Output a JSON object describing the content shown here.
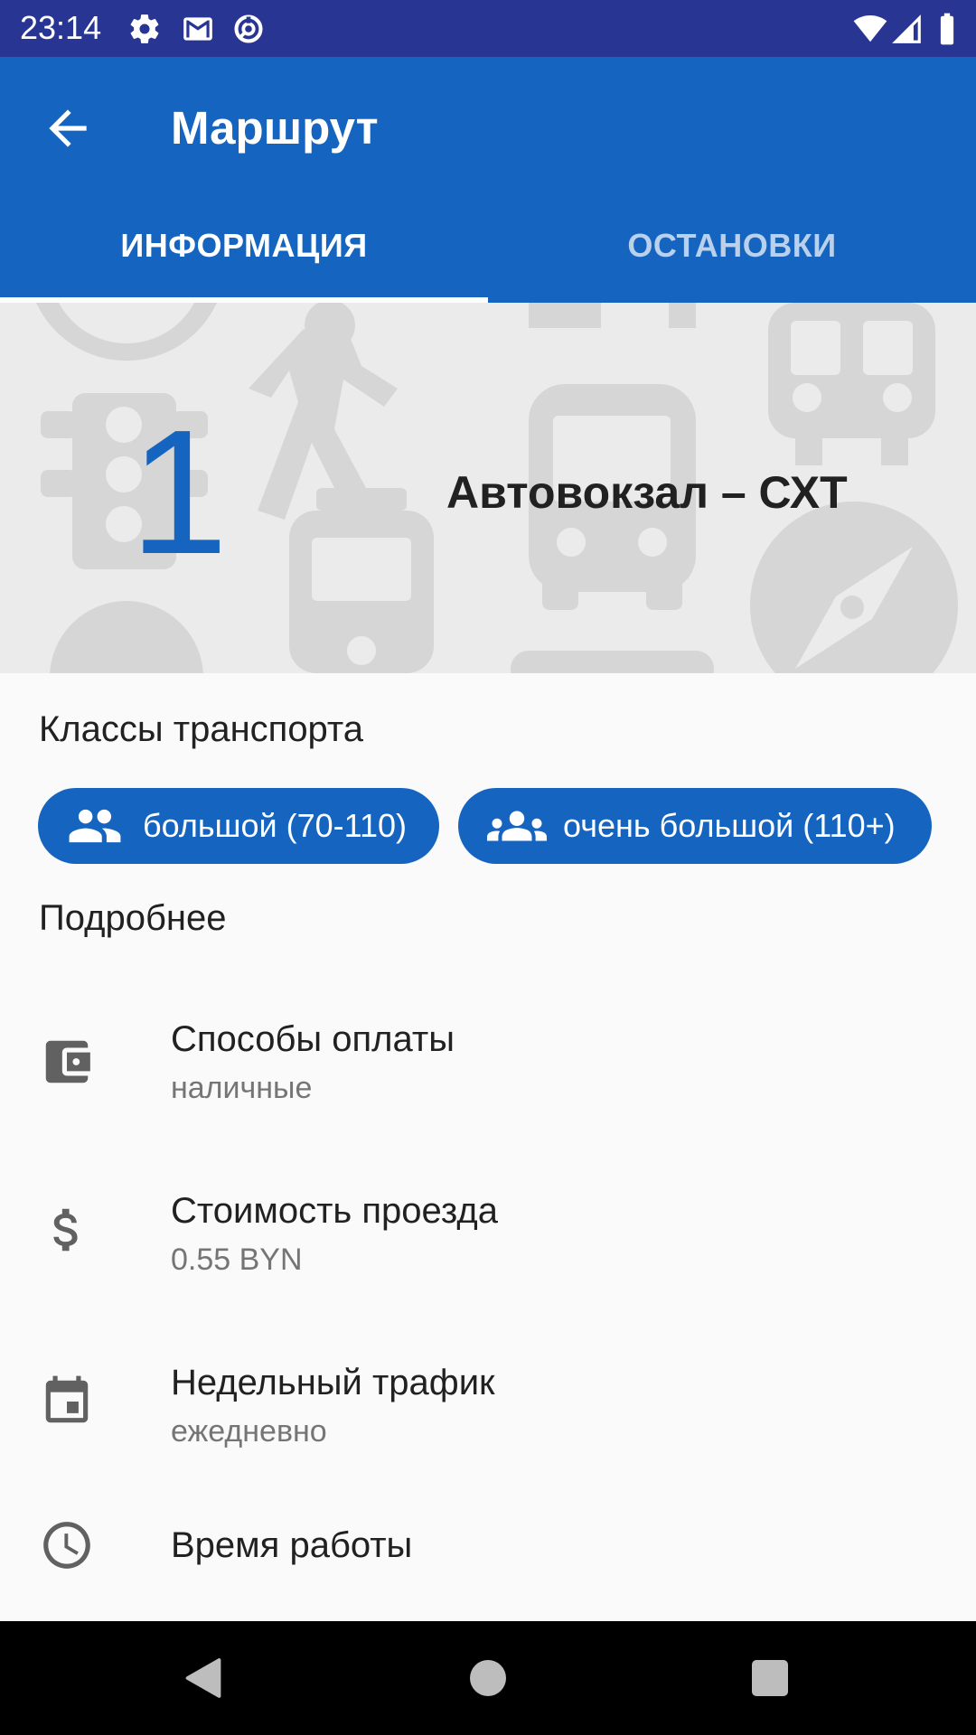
{
  "status_bar": {
    "time": "23:14",
    "icons": [
      "settings-icon",
      "gmail-icon",
      "data-saver-icon",
      "wifi-icon",
      "cell-signal-icon",
      "battery-icon"
    ]
  },
  "app_bar": {
    "title": "Маршрут",
    "back_icon": "arrow-back-icon"
  },
  "tabs": [
    {
      "label": "ИНФОРМАЦИЯ",
      "active": true
    },
    {
      "label": "ОСТАНОВКИ",
      "active": false
    }
  ],
  "route": {
    "number": "1",
    "name": "Автовокзал – СХТ"
  },
  "transport_classes": {
    "title": "Классы транспорта",
    "chips": [
      {
        "icon": "people-icon",
        "label": "большой (70-110)"
      },
      {
        "icon": "groups-icon",
        "label": "очень большой (110+)"
      }
    ]
  },
  "details": {
    "title": "Подробнее",
    "items": [
      {
        "icon": "wallet-icon",
        "title": "Способы оплаты",
        "subtitle": "наличные"
      },
      {
        "icon": "dollar-icon",
        "title": "Стоимость проезда",
        "subtitle": "0.55 BYN"
      },
      {
        "icon": "calendar-icon",
        "title": "Недельный трафик",
        "subtitle": "ежедневно"
      },
      {
        "icon": "clock-icon",
        "title": "Время работы",
        "subtitle": ""
      }
    ]
  },
  "nav_bar": {
    "buttons": [
      "back-triangle-icon",
      "home-circle-icon",
      "recents-square-icon"
    ]
  },
  "colors": {
    "status_bar": "#283593",
    "primary": "#1565c0",
    "hero_background": "#ebebeb",
    "hero_pattern": "#d6d6d6"
  }
}
